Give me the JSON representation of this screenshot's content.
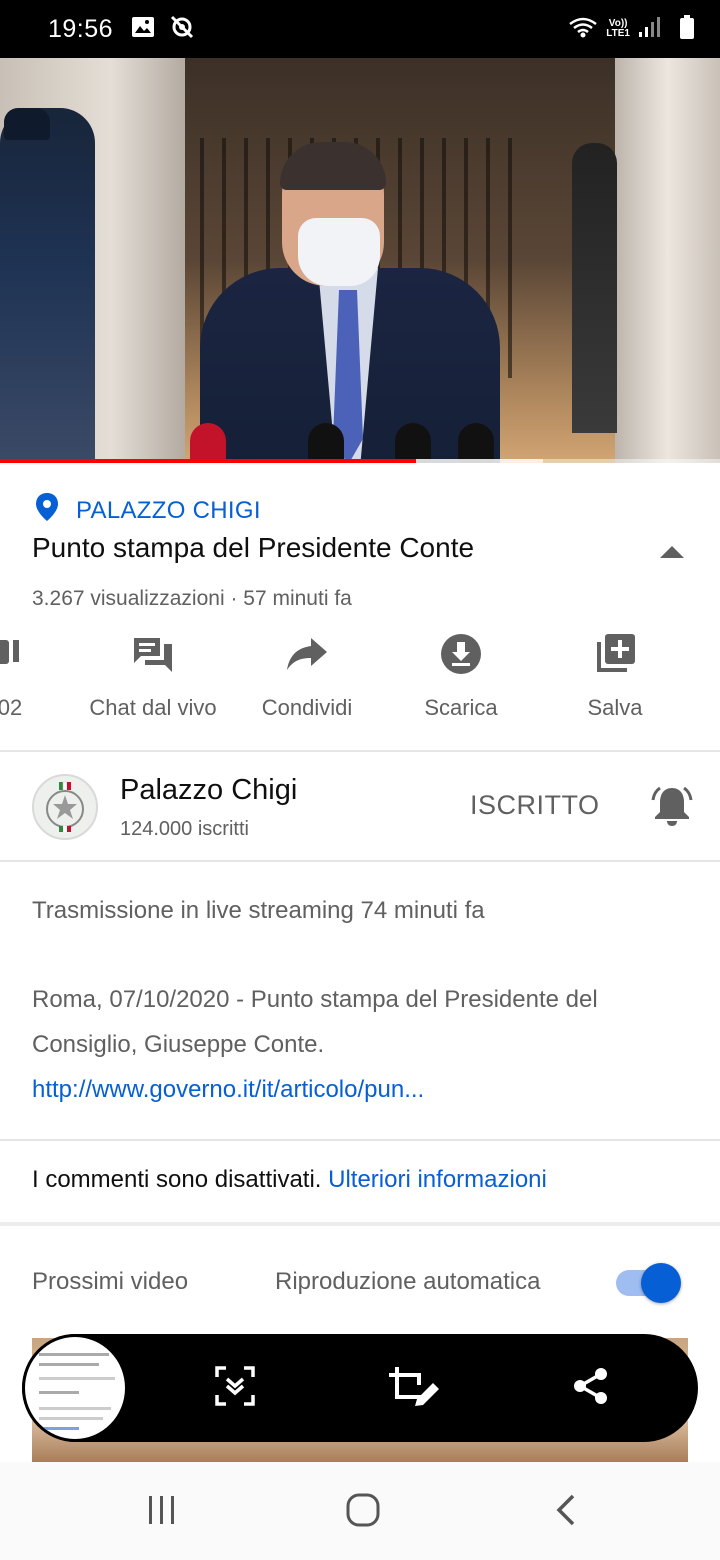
{
  "status_bar": {
    "time": "19:56",
    "net_line1": "Vo))",
    "net_line2": "LTE1"
  },
  "video": {
    "progress_fraction": 0.578,
    "buffer_fraction": 0.754,
    "progress_color": "#ff0000"
  },
  "location": "PALAZZO CHIGI",
  "title": "Punto stampa del Presidente Conte",
  "meta": "3.267 visualizzazioni · 57 minuti fa",
  "actions": [
    {
      "label": "02",
      "icon": "dislike-icon"
    },
    {
      "label": "Chat dal vivo",
      "icon": "live-chat-icon"
    },
    {
      "label": "Condividi",
      "icon": "share-icon"
    },
    {
      "label": "Scarica",
      "icon": "download-icon"
    },
    {
      "label": "Salva",
      "icon": "save-playlist-icon"
    }
  ],
  "channel": {
    "name": "Palazzo Chigi",
    "subscribers": "124.000 iscritti",
    "subscribe_label": "ISCRITTO"
  },
  "description": {
    "line1": "Trasmissione in live streaming 74 minuti fa",
    "body": "Roma, 07/10/2020 - Punto stampa del Presidente del Consiglio, Giuseppe Conte.",
    "link": "http://www.governo.it/it/articolo/pun..."
  },
  "comments": {
    "text": "I commenti sono disattivati.",
    "link": "Ulteriori informazioni"
  },
  "up_next": {
    "label": "Prossimi video",
    "autoplay_label": "Riproduzione automatica",
    "autoplay_on": true
  },
  "colors": {
    "link": "#065fd4",
    "toggle": "#065fd4"
  }
}
